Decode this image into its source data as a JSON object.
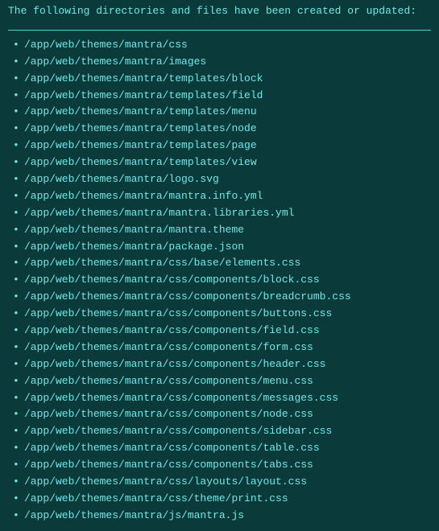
{
  "header": {
    "message": "The following directories and files have been created or updated:"
  },
  "files": [
    "/app/web/themes/mantra/css",
    "/app/web/themes/mantra/images",
    "/app/web/themes/mantra/templates/block",
    "/app/web/themes/mantra/templates/field",
    "/app/web/themes/mantra/templates/menu",
    "/app/web/themes/mantra/templates/node",
    "/app/web/themes/mantra/templates/page",
    "/app/web/themes/mantra/templates/view",
    "/app/web/themes/mantra/logo.svg",
    "/app/web/themes/mantra/mantra.info.yml",
    "/app/web/themes/mantra/mantra.libraries.yml",
    "/app/web/themes/mantra/mantra.theme",
    "/app/web/themes/mantra/package.json",
    "/app/web/themes/mantra/css/base/elements.css",
    "/app/web/themes/mantra/css/components/block.css",
    "/app/web/themes/mantra/css/components/breadcrumb.css",
    "/app/web/themes/mantra/css/components/buttons.css",
    "/app/web/themes/mantra/css/components/field.css",
    "/app/web/themes/mantra/css/components/form.css",
    "/app/web/themes/mantra/css/components/header.css",
    "/app/web/themes/mantra/css/components/menu.css",
    "/app/web/themes/mantra/css/components/messages.css",
    "/app/web/themes/mantra/css/components/node.css",
    "/app/web/themes/mantra/css/components/sidebar.css",
    "/app/web/themes/mantra/css/components/table.css",
    "/app/web/themes/mantra/css/components/tabs.css",
    "/app/web/themes/mantra/css/layouts/layout.css",
    "/app/web/themes/mantra/css/theme/print.css",
    "/app/web/themes/mantra/js/mantra.js"
  ]
}
